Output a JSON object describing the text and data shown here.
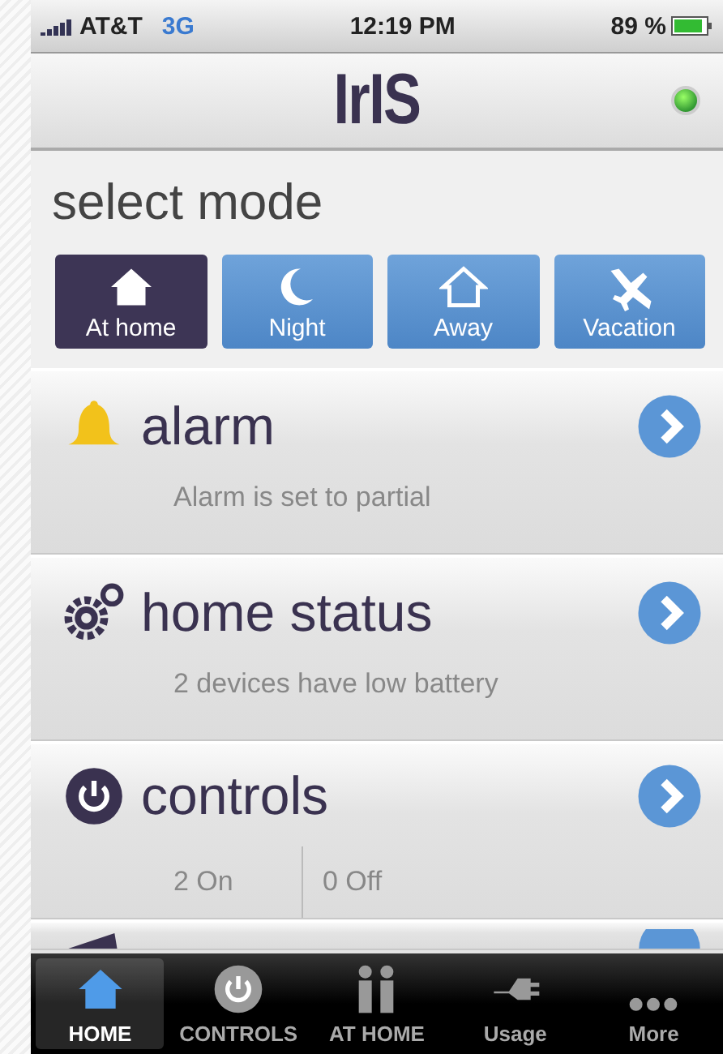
{
  "status_bar": {
    "carrier": "AT&T",
    "network": "3G",
    "time": "12:19 PM",
    "battery": "89 %"
  },
  "header": {
    "logo": "IrIS",
    "connected": true
  },
  "mode_title": "select mode",
  "modes": [
    {
      "label": "At home",
      "selected": true
    },
    {
      "label": "Night",
      "selected": false
    },
    {
      "label": "Away",
      "selected": false
    },
    {
      "label": "Vacation",
      "selected": false
    }
  ],
  "cards": [
    {
      "title": "alarm",
      "kind": "text",
      "detail": "Alarm is set to partial"
    },
    {
      "title": "home status",
      "kind": "text",
      "detail": "2 devices have low battery"
    },
    {
      "title": "controls",
      "kind": "split",
      "left": "2 On",
      "right": "0 Off"
    },
    {
      "kind": "partial"
    }
  ],
  "tabs": [
    {
      "label": "HOME",
      "selected": true
    },
    {
      "label": "CONTROLS",
      "selected": false
    },
    {
      "label": "AT HOME",
      "selected": false
    },
    {
      "label": "Usage",
      "selected": false
    },
    {
      "label": "More",
      "selected": false
    }
  ]
}
